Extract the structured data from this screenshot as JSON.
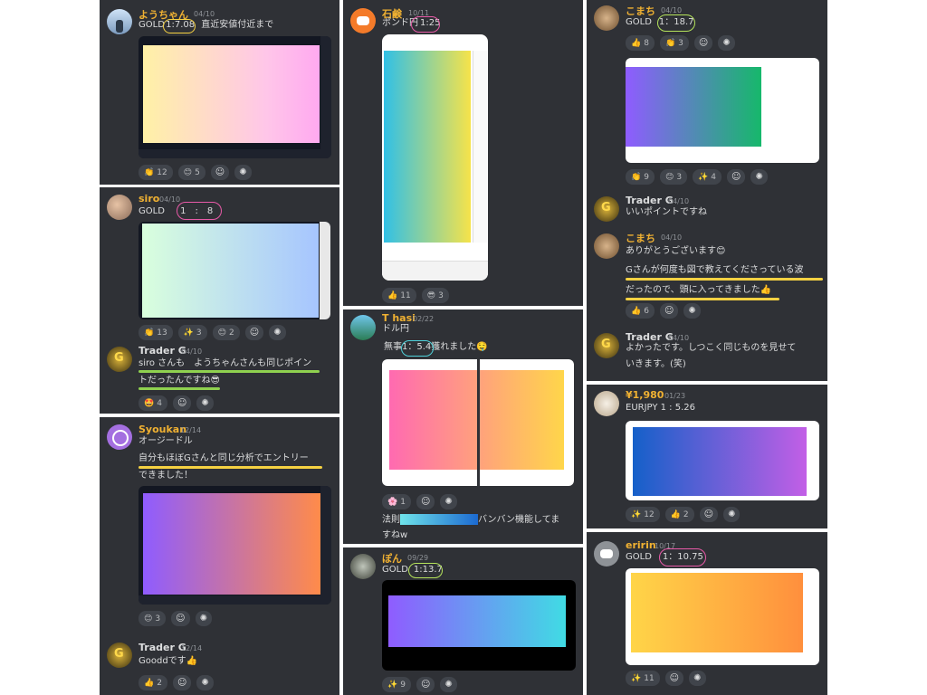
{
  "reactions_add_icon": "add-reaction-icon",
  "p1": {
    "m1": {
      "name": "ようちゃん",
      "date": "04/10",
      "text_prefix": "GOLD",
      "ratio": "1:7.08",
      "text_suffix": "直近安値付近まで",
      "reactions": [
        {
          "emoji": "👏",
          "count": "12"
        },
        {
          "emoji": "😊",
          "count": "5"
        }
      ]
    },
    "m2": {
      "name": "siro",
      "date": "04/10",
      "text_prefix": "GOLD",
      "ratio": "1　:　8",
      "reactions": [
        {
          "emoji": "👏",
          "count": "13"
        },
        {
          "emoji": "✨",
          "count": "3"
        },
        {
          "emoji": "😊",
          "count": "2"
        }
      ]
    },
    "m3": {
      "name": "Trader G",
      "date": "04/10",
      "line1": "siro さんも　ようちゃんさんも同じポイン",
      "line2": "トだったんですね😎",
      "reactions": [
        {
          "emoji": "🤩",
          "count": "4"
        }
      ]
    },
    "m4": {
      "name": "Syoukan",
      "date": "12/14",
      "line1": "オージードル",
      "line2": "自分もほぼGさんと同じ分析でエントリー",
      "line3": "できました！",
      "reactions": [
        {
          "emoji": "😊",
          "count": "3"
        }
      ]
    },
    "m5": {
      "name": "Trader G",
      "date": "12/14",
      "text": "Gooddです👍",
      "reactions": [
        {
          "emoji": "👍",
          "count": "2"
        }
      ]
    }
  },
  "p2": {
    "m1": {
      "name": "石鹸",
      "date": "10/11",
      "text_prefix": "ポンド円",
      "ratio": "1:25",
      "reactions": [
        {
          "emoji": "👍",
          "count": "11"
        },
        {
          "emoji": "😎",
          "count": "3"
        }
      ]
    },
    "m2": {
      "name": "T hasi",
      "date": "02/22",
      "line1": "ドル円",
      "line2_prefix": "無事",
      "ratio": "1：5.4",
      "line2_suffix": "獲れました🤤",
      "reactions": [
        {
          "emoji": "🌸",
          "count": "1"
        }
      ],
      "line3_prefix": "法則",
      "line3_suffix": "バンバン機能してま",
      "line4": "すねw"
    },
    "m3": {
      "name": "ぽん",
      "date": "09/29",
      "text_prefix": "GOLD",
      "ratio": "1:13.7",
      "reactions": [
        {
          "emoji": "✨",
          "count": "9"
        }
      ]
    }
  },
  "p3": {
    "m1": {
      "name": "こまち",
      "date": "04/10",
      "text_prefix": "GOLD",
      "ratio": "1：18.7",
      "reactions": [
        {
          "emoji": "👍",
          "count": "8"
        },
        {
          "emoji": "👏",
          "count": "3"
        }
      ],
      "reactions2": [
        {
          "emoji": "👏",
          "count": "9"
        },
        {
          "emoji": "😊",
          "count": "3"
        },
        {
          "emoji": "✨",
          "count": "4"
        }
      ]
    },
    "m2": {
      "name": "Trader G",
      "date": "04/10",
      "text": "いいポイントですね"
    },
    "m3": {
      "name": "こまち",
      "date": "04/10",
      "line1": "ありがとうございます😊",
      "line2": "Gさんが何度も図で教えてくださっている波",
      "line3": "だったので、頭に入ってきました👍",
      "reactions": [
        {
          "emoji": "👍",
          "count": "6"
        }
      ]
    },
    "m4": {
      "name": "Trader G",
      "date": "04/10",
      "line1": "よかったです。しつこく同じものを見せて",
      "line2": "いきます。(笑)"
    }
  },
  "p4": {
    "m1": {
      "name": "¥1,980",
      "date": "01/23",
      "text": "EURJPY 1 : 5.26",
      "reactions": [
        {
          "emoji": "✨",
          "count": "12"
        },
        {
          "emoji": "👍",
          "count": "2"
        }
      ]
    },
    "m2": {
      "name": "eririn",
      "date": "10/17",
      "text_prefix": "GOLD",
      "ratio": "1：10.75",
      "reactions": [
        {
          "emoji": "✨",
          "count": "11"
        }
      ]
    }
  },
  "colors": {
    "panel": "#2f3136",
    "name": "#f0b132",
    "highlight_yellow": "#f5d142",
    "highlight_green": "#8fd14f",
    "ring_pink": "#e85aa8",
    "ring_green": "#b5e35b",
    "ring_cyan": "#4fd1d9",
    "ring_yellow": "#f5d142"
  }
}
